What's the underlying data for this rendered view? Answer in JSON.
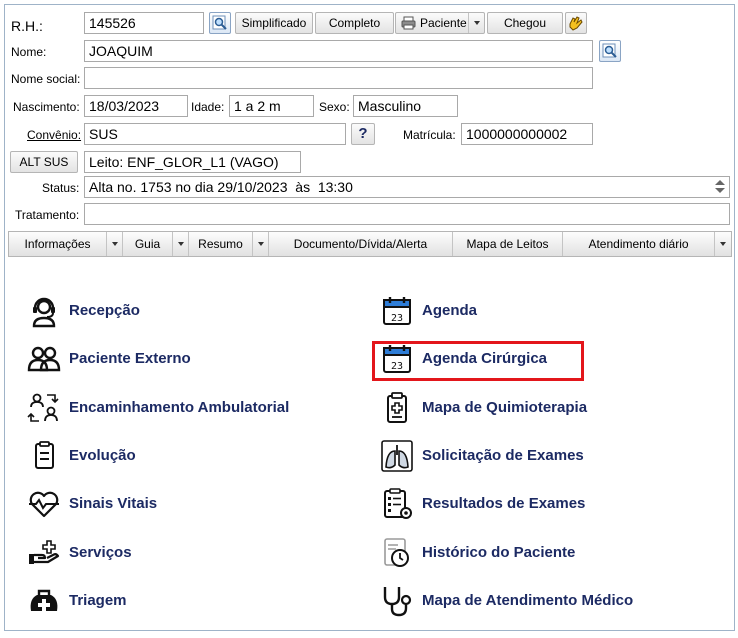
{
  "form": {
    "rh_label": "R.H.:",
    "rh_value": "145526",
    "btn_simplificado": "Simplificado",
    "btn_completo": "Completo",
    "btn_paciente": "Paciente",
    "btn_chegou": "Chegou",
    "nome_label": "Nome:",
    "nome_value": "JOAQUIM",
    "nome_social_label": "Nome social:",
    "nome_social_value": "",
    "nascimento_label": "Nascimento:",
    "nascimento_value": "18/03/2023",
    "idade_label": "Idade:",
    "idade_value": "1 a 2 m",
    "sexo_label": "Sexo:",
    "sexo_value": "Masculino",
    "convenio_label": "Convênio:",
    "convenio_value": "SUS",
    "help_label": "?",
    "matricula_label": "Matrícula:",
    "matricula_value": "1000000000002",
    "alt_sus_label": "ALT SUS",
    "leito_value": "Leito: ENF_GLOR_L1 (VAGO)",
    "status_label": "Status:",
    "status_value": "Alta no. 1753 no dia 29/10/2023  às  13:30",
    "tratamento_label": "Tratamento:",
    "tratamento_value": ""
  },
  "tabs": [
    {
      "label": "Informações"
    },
    {
      "label": "Guia"
    },
    {
      "label": "Resumo"
    },
    {
      "label": "Documento/Dívida/Alerta"
    },
    {
      "label": "Mapa de Leitos"
    },
    {
      "label": "Atendimento diário"
    }
  ],
  "menu_left": [
    {
      "label": "Recepção",
      "icon": "headset-icon"
    },
    {
      "label": "Paciente Externo",
      "icon": "users-icon"
    },
    {
      "label": "Encaminhamento Ambulatorial",
      "icon": "referral-icon"
    },
    {
      "label": "Evolução",
      "icon": "clipboard-icon"
    },
    {
      "label": "Sinais Vitais",
      "icon": "heartbeat-icon"
    },
    {
      "label": "Serviços",
      "icon": "hand-service-icon"
    },
    {
      "label": "Triagem",
      "icon": "medical-kit-icon"
    }
  ],
  "menu_right": [
    {
      "label": "Agenda",
      "icon": "calendar-icon"
    },
    {
      "label": "Agenda Cirúrgica",
      "icon": "calendar-icon"
    },
    {
      "label": "Mapa de Quimioterapia",
      "icon": "medical-clipboard-icon"
    },
    {
      "label": "Solicitação de Exames",
      "icon": "lungs-icon"
    },
    {
      "label": "Resultados de Exames",
      "icon": "results-icon"
    },
    {
      "label": "Histórico do Paciente",
      "icon": "history-icon"
    },
    {
      "label": "Mapa de Atendimento Médico",
      "icon": "stethoscope-icon"
    }
  ],
  "calendar_day": "23",
  "colors": {
    "menu_text": "#1c2a63",
    "highlight": "#e3161b"
  }
}
